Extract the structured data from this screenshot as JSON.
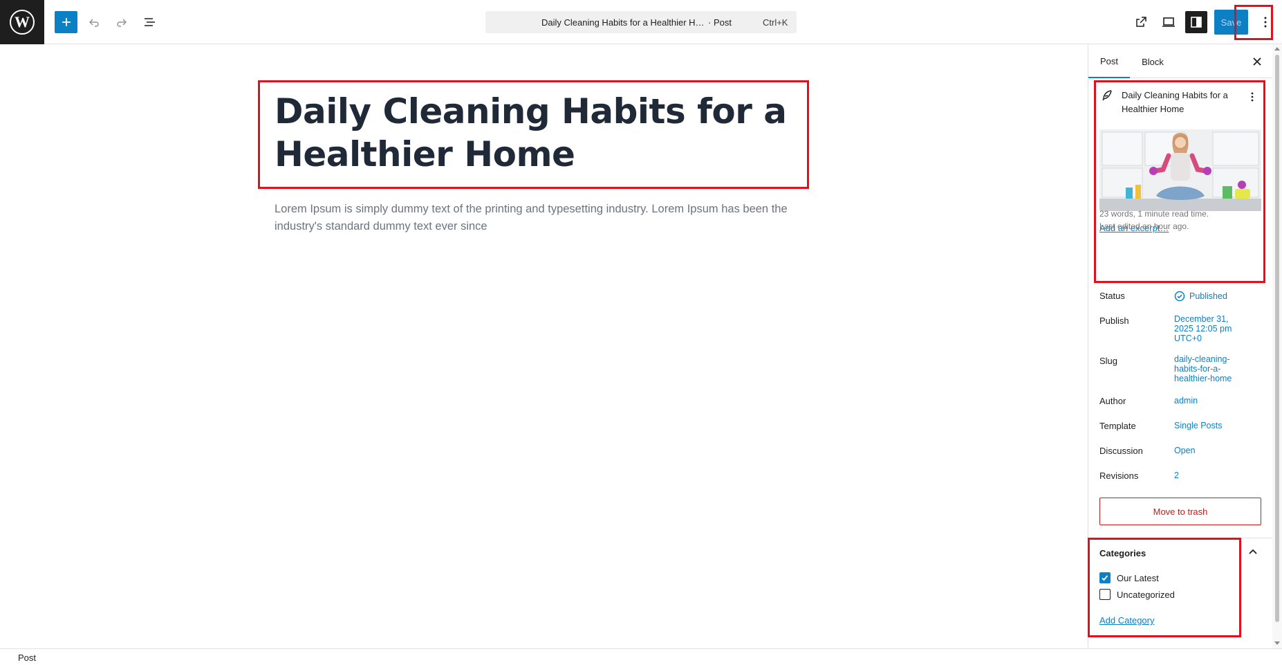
{
  "topbar": {
    "command_title": "Daily Cleaning Habits for a Healthier H…",
    "command_type": "· Post",
    "command_shortcut": "Ctrl+K",
    "save_label": "Save"
  },
  "editor": {
    "title": "Daily Cleaning Habits for a Healthier Home",
    "paragraph": "Lorem Ipsum is simply dummy text of the printing and typesetting industry. Lorem Ipsum has been the industry's standard dummy text ever since"
  },
  "sidebar": {
    "tabs": [
      {
        "label": "Post"
      },
      {
        "label": "Block"
      }
    ],
    "summary": {
      "title": "Daily Cleaning Habits for a Healthier Home",
      "add_excerpt": "Add an excerpt…",
      "word_count": "23 words, 1 minute read time.",
      "last_edited": "Last edited an hour ago."
    },
    "rows": {
      "status_label": "Status",
      "status_value": "Published",
      "publish_label": "Publish",
      "publish_value": "December 31, 2025 12:05 pm UTC+0",
      "slug_label": "Slug",
      "slug_value": "daily-cleaning-habits-for-a-healthier-home",
      "author_label": "Author",
      "author_value": "admin",
      "template_label": "Template",
      "template_value": "Single Posts",
      "discussion_label": "Discussion",
      "discussion_value": "Open",
      "revisions_label": "Revisions",
      "revisions_value": "2"
    },
    "trash_label": "Move to trash",
    "categories": {
      "heading": "Categories",
      "items": [
        {
          "label": "Our Latest",
          "checked": true
        },
        {
          "label": "Uncategorized",
          "checked": false
        }
      ],
      "add_label": "Add Category"
    }
  },
  "footer": {
    "breadcrumb": "Post"
  },
  "colors": {
    "accent": "#0c80c5",
    "highlight": "#e0101c",
    "destructive": "#cc1818"
  }
}
